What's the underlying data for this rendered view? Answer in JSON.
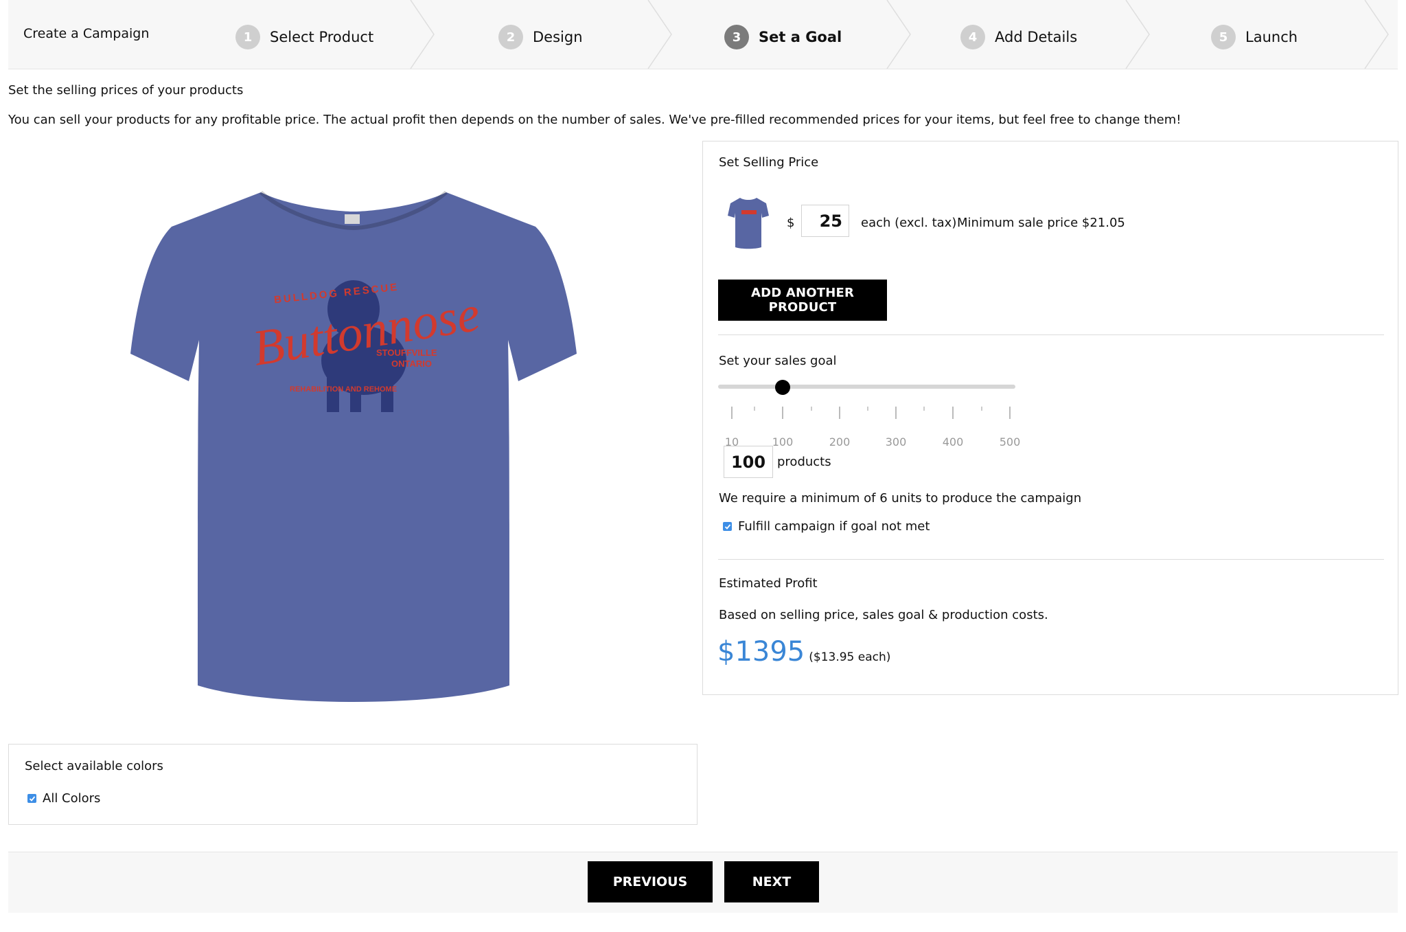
{
  "header": {
    "create_label": "Create a Campaign",
    "steps": [
      {
        "num": "1",
        "label": "Select Product"
      },
      {
        "num": "2",
        "label": "Design"
      },
      {
        "num": "3",
        "label": "Set a Goal"
      },
      {
        "num": "4",
        "label": "Add Details"
      },
      {
        "num": "5",
        "label": "Launch"
      }
    ],
    "active_step": 3
  },
  "intro": {
    "title": "Set the selling prices of your products",
    "description": "You can sell your products for any profitable price. The actual profit then depends on the number of sales. We've pre-filled recommended prices for your items, but feel free to change them!"
  },
  "preview": {
    "shirt_color": "#5866a3",
    "print_color": "#d23a2e",
    "dog_color": "#2e3a7a",
    "print_arc_text": "BULLDOG RESCUE",
    "print_script": "Buttonnose",
    "print_location_1": "STOUFFVILLE",
    "print_location_2": "ONTARIO",
    "print_tagline": "REHABILITION AND REHOME"
  },
  "colors_panel": {
    "title": "Select available colors",
    "all_colors_label": "All Colors",
    "all_colors_checked": true
  },
  "pricing": {
    "title": "Set Selling Price",
    "currency": "$",
    "price_value": "25",
    "each_label": "each (excl. tax)",
    "minimum_text": "Minimum sale price $21.05",
    "add_product_label": "Add another product"
  },
  "goal": {
    "title": "Set your sales goal",
    "slider_value": 100,
    "slider_min": 0,
    "slider_max": 525,
    "tick_labels": [
      "10",
      "100",
      "200",
      "300",
      "400",
      "500"
    ],
    "value": "100",
    "unit_label": "products",
    "requirement_text": "We require a minimum of 6 units to produce the campaign",
    "fulfill_label": "Fulfill campaign if goal not met",
    "fulfill_checked": true
  },
  "profit": {
    "title": "Estimated Profit",
    "description": "Based on selling price, sales goal & production costs.",
    "amount": "$1395",
    "per_item": "($13.95 each)",
    "accent_color": "#3a86d6"
  },
  "nav": {
    "previous_label": "Previous",
    "next_label": "Next"
  }
}
